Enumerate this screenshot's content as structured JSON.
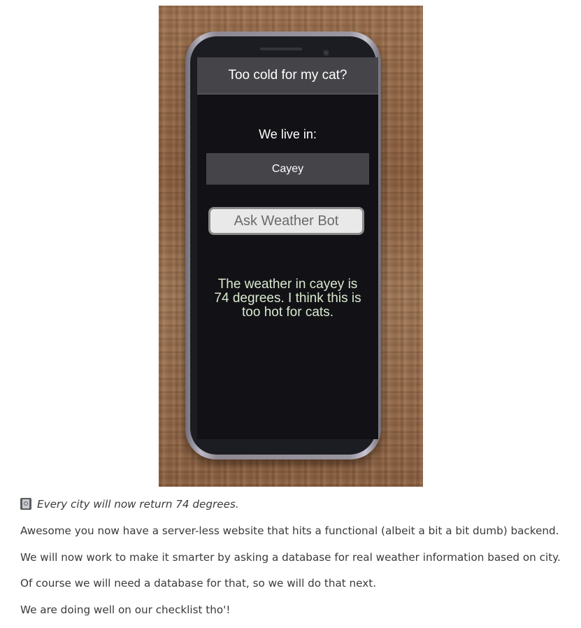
{
  "app": {
    "title": "Too cold for my cat?",
    "location_label": "We live in:",
    "city_value": "Cayey",
    "button_label": "Ask Weather Bot",
    "result_text": "The weather in cayey is 74 degrees. I think this is too hot for cats."
  },
  "article": {
    "note_icon": "book-icon",
    "note": "Every city will now return 74 degrees.",
    "paragraphs": [
      "Awesome you now have a server-less website that hits a functional (albeit a bit a bit dumb) backend.",
      "We will now work to make it smarter by asking a database for real weather information based on city.",
      "Of course we will need a database for that, so we will do that next.",
      "We are doing well on our checklist tho'!"
    ]
  },
  "colors": {
    "app_background": "#121216",
    "header_background": "#454449",
    "input_background": "#454449",
    "button_background": "#e9e9e9",
    "result_text": "#d9e9cf",
    "article_text": "#3a3a3a"
  }
}
